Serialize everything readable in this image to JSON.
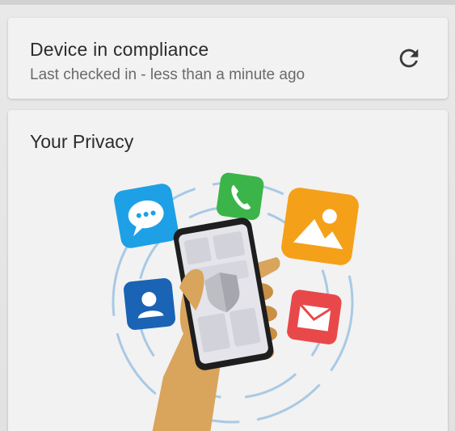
{
  "compliance_card": {
    "title": "Device in compliance",
    "subtitle": "Last checked in - less than a minute ago",
    "refresh_icon": "refresh-icon"
  },
  "privacy_card": {
    "title": "Your Privacy",
    "illustration_icons": [
      "chat-icon",
      "phone-icon",
      "photo-icon",
      "contact-icon",
      "mail-icon",
      "shield-icon"
    ]
  },
  "colors": {
    "card_background": "#f2f2f2",
    "chat_blue": "#1ea0e6",
    "phone_green": "#3bb54a",
    "photo_orange": "#f5a019",
    "contact_blue": "#1a63b5",
    "mail_red": "#e8484a",
    "hand_tan": "#d9a45c",
    "ring_blue": "#a9c9e4"
  }
}
